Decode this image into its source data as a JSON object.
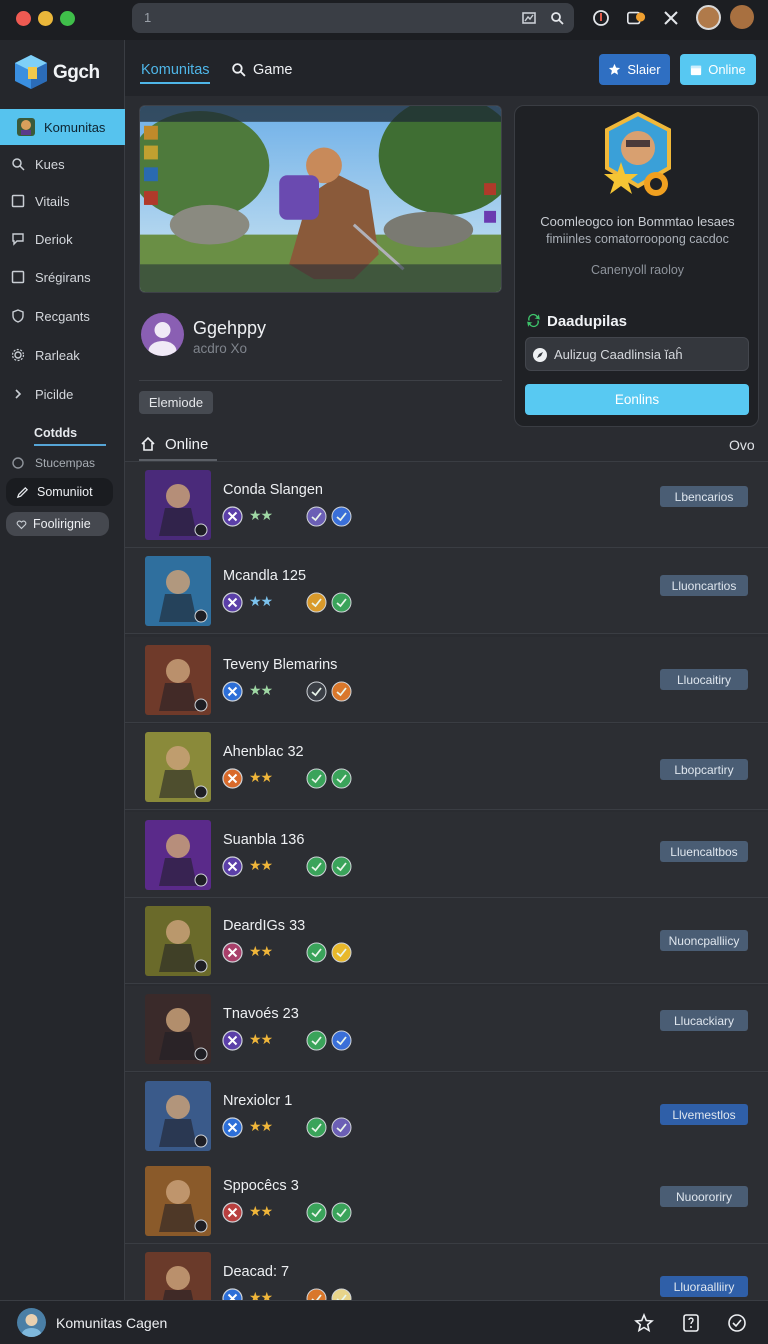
{
  "address": {
    "text": "1"
  },
  "sidebar": {
    "logo_text": "Ggch",
    "items": [
      {
        "label": "Komunitas",
        "icon": "game-icon"
      },
      {
        "label": "Kues",
        "icon": "magnifier-icon"
      },
      {
        "label": "Vitails",
        "icon": "square-icon"
      },
      {
        "label": "Deriok",
        "icon": "chat-icon"
      },
      {
        "label": "Srégirans",
        "icon": "square-icon"
      },
      {
        "label": "Recgants",
        "icon": "shield-icon"
      },
      {
        "label": "Rarleak",
        "icon": "gear-icon"
      },
      {
        "label": "Picilde",
        "icon": "chevron-right-icon"
      }
    ],
    "sub_heading": "Cotdds",
    "sub_items": [
      {
        "label": "Stucempas",
        "icon": "circle-icon"
      },
      {
        "label": "Somuniiot",
        "icon": "pen-icon"
      },
      {
        "label": "Foolirignie",
        "icon": "heart-icon"
      }
    ]
  },
  "header": {
    "tab_community": "Komunitas",
    "tab_game": "Game",
    "btn_star": "Slaier",
    "btn_online": "Online"
  },
  "profile": {
    "name": "Ggehppy",
    "sub": "acdro Xo",
    "chip": "Elemiode"
  },
  "card": {
    "desc_line1": "Coomleogco ion Bommtao lesaes",
    "desc_line2": "fimiinles comatorroopong cacdoc",
    "note": "Canenyoll raoloy",
    "title": "Daadupilas",
    "input_value": "Aulizug Caadlinsia ĭaĥ",
    "button": "Eonlins"
  },
  "list": {
    "header_label": "Online",
    "header_right": "Ovo",
    "rows": [
      {
        "title": "Conda Slangen",
        "button": "Lbencarios",
        "stars": "★★",
        "star_color": "#9fd8a4",
        "badge": "#5b3fa8",
        "i1": "#6b5fb5",
        "i2": "#3a6fd8",
        "btn_color": "#4a5d74",
        "thumb": "#4a2a7a"
      },
      {
        "title": "Mcandla 125",
        "button": "Lluoncartios",
        "stars": "★★",
        "star_color": "#7cc3ee",
        "badge": "#5b3fa8",
        "i1": "#d99a2b",
        "i2": "#3aa35a",
        "btn_color": "#4a5d74",
        "thumb": "#2f6f9e"
      },
      {
        "title": "Teveny Blemarins",
        "button": "Lluocaitiry",
        "stars": "★★",
        "star_color": "#9fd8a4",
        "badge": "#2d6fd8",
        "i1": "#3b3f46",
        "i2": "#d9772b",
        "btn_color": "#4a5d74",
        "thumb": "#6f3a2a"
      },
      {
        "title": "Ahenblac 32",
        "button": "Lbopcartiry",
        "stars": "★★",
        "star_color": "#f0b63a",
        "badge": "#d96a2b",
        "i1": "#3aa35a",
        "i2": "#3aa35a",
        "btn_color": "#4a5d74",
        "thumb": "#8a8a3a"
      },
      {
        "title": "Suanbla 136",
        "button": "Lluencaltbos",
        "stars": "★★",
        "star_color": "#f0b63a",
        "badge": "#5b3fa8",
        "i1": "#3aa35a",
        "i2": "#3aa35a",
        "btn_color": "#4a5d74",
        "thumb": "#5a2a8a"
      },
      {
        "title": "DeardIGs 33",
        "button": "Nuoncpalliicy",
        "stars": "★★",
        "star_color": "#f0b63a",
        "badge": "#a83f6a",
        "i1": "#3aa35a",
        "i2": "#e8b82b",
        "btn_color": "#4a5d74",
        "thumb": "#6a6a2a"
      },
      {
        "title": "Tnavoés 23",
        "button": "Llucackiary",
        "stars": "★★",
        "star_color": "#f0b63a",
        "badge": "#5b3fa8",
        "i1": "#3aa35a",
        "i2": "#3a6fd8",
        "btn_color": "#4a5d74",
        "thumb": "#3a2a2a"
      },
      {
        "title": "Nrexiolcr 1",
        "button": "Llvemestlos",
        "stars": "★★",
        "star_color": "#f0b63a",
        "badge": "#2d6fd8",
        "i1": "#3aa35a",
        "i2": "#6b5fb5",
        "btn_color": "#2f5fa8",
        "thumb": "#3a5a8a"
      },
      {
        "title": "Sppocêcs 3",
        "button": "Nuoororiry",
        "stars": "★★",
        "star_color": "#f0b63a",
        "badge": "#b83f3f",
        "i1": "#3aa35a",
        "i2": "#3aa35a",
        "btn_color": "#4a5d74",
        "thumb": "#8a5a2a"
      },
      {
        "title": "Deacad: 7",
        "button": "Lluoraalliiry",
        "stars": "★★",
        "star_color": "#f0b63a",
        "badge": "#2d6fd8",
        "i1": "#d9772b",
        "i2": "#e8d48a",
        "btn_color": "#2f5fa8",
        "thumb": "#6a3a2a"
      }
    ]
  },
  "bottom": {
    "name": "Komunitas Cagen"
  }
}
